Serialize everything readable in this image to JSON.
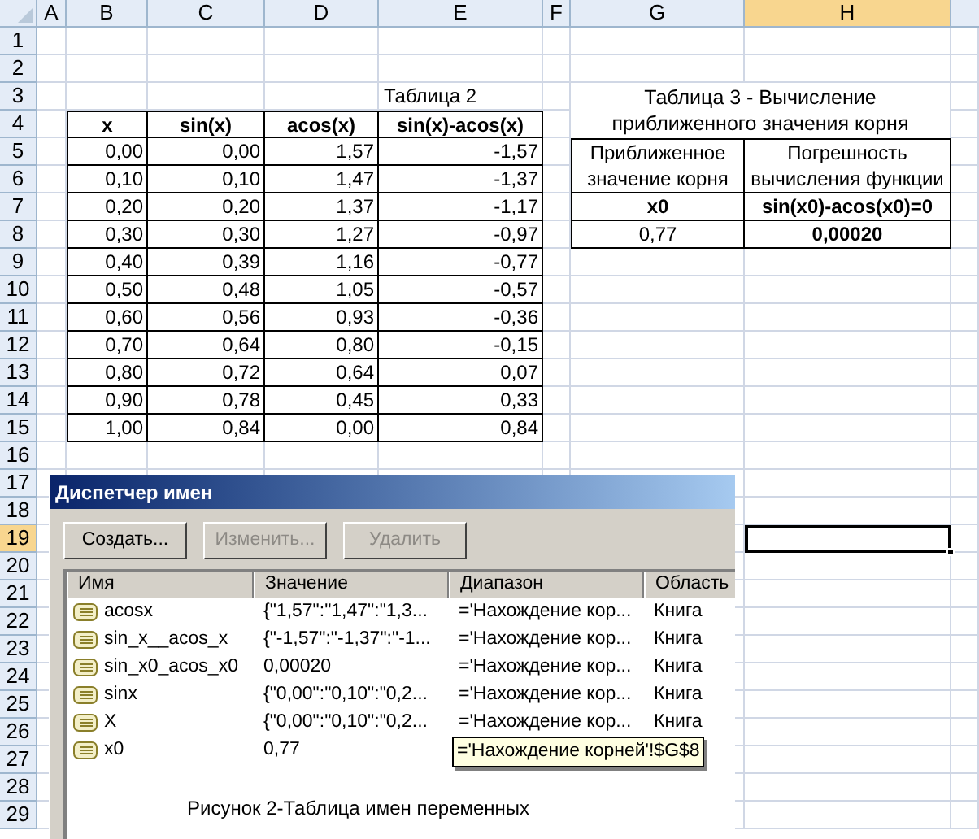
{
  "columns": [
    {
      "label": "A",
      "selected": false
    },
    {
      "label": "B",
      "selected": false
    },
    {
      "label": "C",
      "selected": false
    },
    {
      "label": "D",
      "selected": false
    },
    {
      "label": "E",
      "selected": false
    },
    {
      "label": "F",
      "selected": false
    },
    {
      "label": "G",
      "selected": false
    },
    {
      "label": "H",
      "selected": true
    }
  ],
  "rows": [
    {
      "label": "1",
      "selected": false
    },
    {
      "label": "2",
      "selected": false
    },
    {
      "label": "3",
      "selected": false
    },
    {
      "label": "4",
      "selected": false
    },
    {
      "label": "5",
      "selected": false
    },
    {
      "label": "6",
      "selected": false
    },
    {
      "label": "7",
      "selected": false
    },
    {
      "label": "8",
      "selected": false
    },
    {
      "label": "9",
      "selected": false
    },
    {
      "label": "10",
      "selected": false
    },
    {
      "label": "11",
      "selected": false
    },
    {
      "label": "12",
      "selected": false
    },
    {
      "label": "13",
      "selected": false
    },
    {
      "label": "14",
      "selected": false
    },
    {
      "label": "15",
      "selected": false
    },
    {
      "label": "16",
      "selected": false
    },
    {
      "label": "17",
      "selected": false
    },
    {
      "label": "18",
      "selected": false
    },
    {
      "label": "19",
      "selected": true
    },
    {
      "label": "20",
      "selected": false
    },
    {
      "label": "21",
      "selected": false
    },
    {
      "label": "22",
      "selected": false
    },
    {
      "label": "23",
      "selected": false
    },
    {
      "label": "24",
      "selected": false
    },
    {
      "label": "25",
      "selected": false
    },
    {
      "label": "26",
      "selected": false
    },
    {
      "label": "27",
      "selected": false
    },
    {
      "label": "28",
      "selected": false
    },
    {
      "label": "29",
      "selected": false
    }
  ],
  "table2": {
    "caption": "Таблица 2",
    "headers": [
      "x",
      "sin(x)",
      "acos(x)",
      "sin(x)-acos(x)"
    ],
    "rows": [
      [
        "0,00",
        "0,00",
        "1,57",
        "-1,57"
      ],
      [
        "0,10",
        "0,10",
        "1,47",
        "-1,37"
      ],
      [
        "0,20",
        "0,20",
        "1,37",
        "-1,17"
      ],
      [
        "0,30",
        "0,30",
        "1,27",
        "-0,97"
      ],
      [
        "0,40",
        "0,39",
        "1,16",
        "-0,77"
      ],
      [
        "0,50",
        "0,48",
        "1,05",
        "-0,57"
      ],
      [
        "0,60",
        "0,56",
        "0,93",
        "-0,36"
      ],
      [
        "0,70",
        "0,64",
        "0,80",
        "-0,15"
      ],
      [
        "0,80",
        "0,72",
        "0,64",
        "0,07"
      ],
      [
        "0,90",
        "0,78",
        "0,45",
        "0,33"
      ],
      [
        "1,00",
        "0,84",
        "0,00",
        "0,84"
      ]
    ]
  },
  "table3": {
    "caption_lines": [
      "Таблица 3 - Вычисление",
      "приближенного значения корня"
    ],
    "headers": [
      [
        "Приближенное",
        "значение корня"
      ],
      [
        "Погрешность",
        "вычисления функции"
      ]
    ],
    "formula_row": [
      "x0",
      "sin(x0)-acos(x0)=0"
    ],
    "value_row": [
      "0,77",
      "0,00020"
    ]
  },
  "dialog": {
    "title": "Диспетчер имен",
    "buttons": [
      {
        "label": "Создать...",
        "disabled": false
      },
      {
        "label": "Изменить...",
        "disabled": true
      },
      {
        "label": "Удалить",
        "disabled": true
      }
    ],
    "columns": [
      "Имя",
      "Значение",
      "Диапазон",
      "Область"
    ],
    "rows": [
      {
        "name": "acosx",
        "value": "{\"1,57\":\"1,47\":\"1,3...",
        "range": "='Нахождение кор...",
        "scope": "Книга"
      },
      {
        "name": "sin_x__acos_x",
        "value": "{\"-1,57\":\"-1,37\":\"-1...",
        "range": "='Нахождение кор...",
        "scope": "Книга"
      },
      {
        "name": "sin_x0_acos_x0",
        "value": "0,00020",
        "range": "='Нахождение кор...",
        "scope": "Книга"
      },
      {
        "name": "sinx",
        "value": "{\"0,00\":\"0,10\":\"0,2...",
        "range": "='Нахождение кор...",
        "scope": "Книга"
      },
      {
        "name": "X",
        "value": "{\"0,00\":\"0,10\":\"0,2...",
        "range": "='Нахождение кор...",
        "scope": "Книга"
      },
      {
        "name": "x0",
        "value": "0,77"
      }
    ],
    "tooltip": "='Нахождение корней'!$G$8",
    "caption": "Рисунок 2-Таблица имен переменных"
  }
}
